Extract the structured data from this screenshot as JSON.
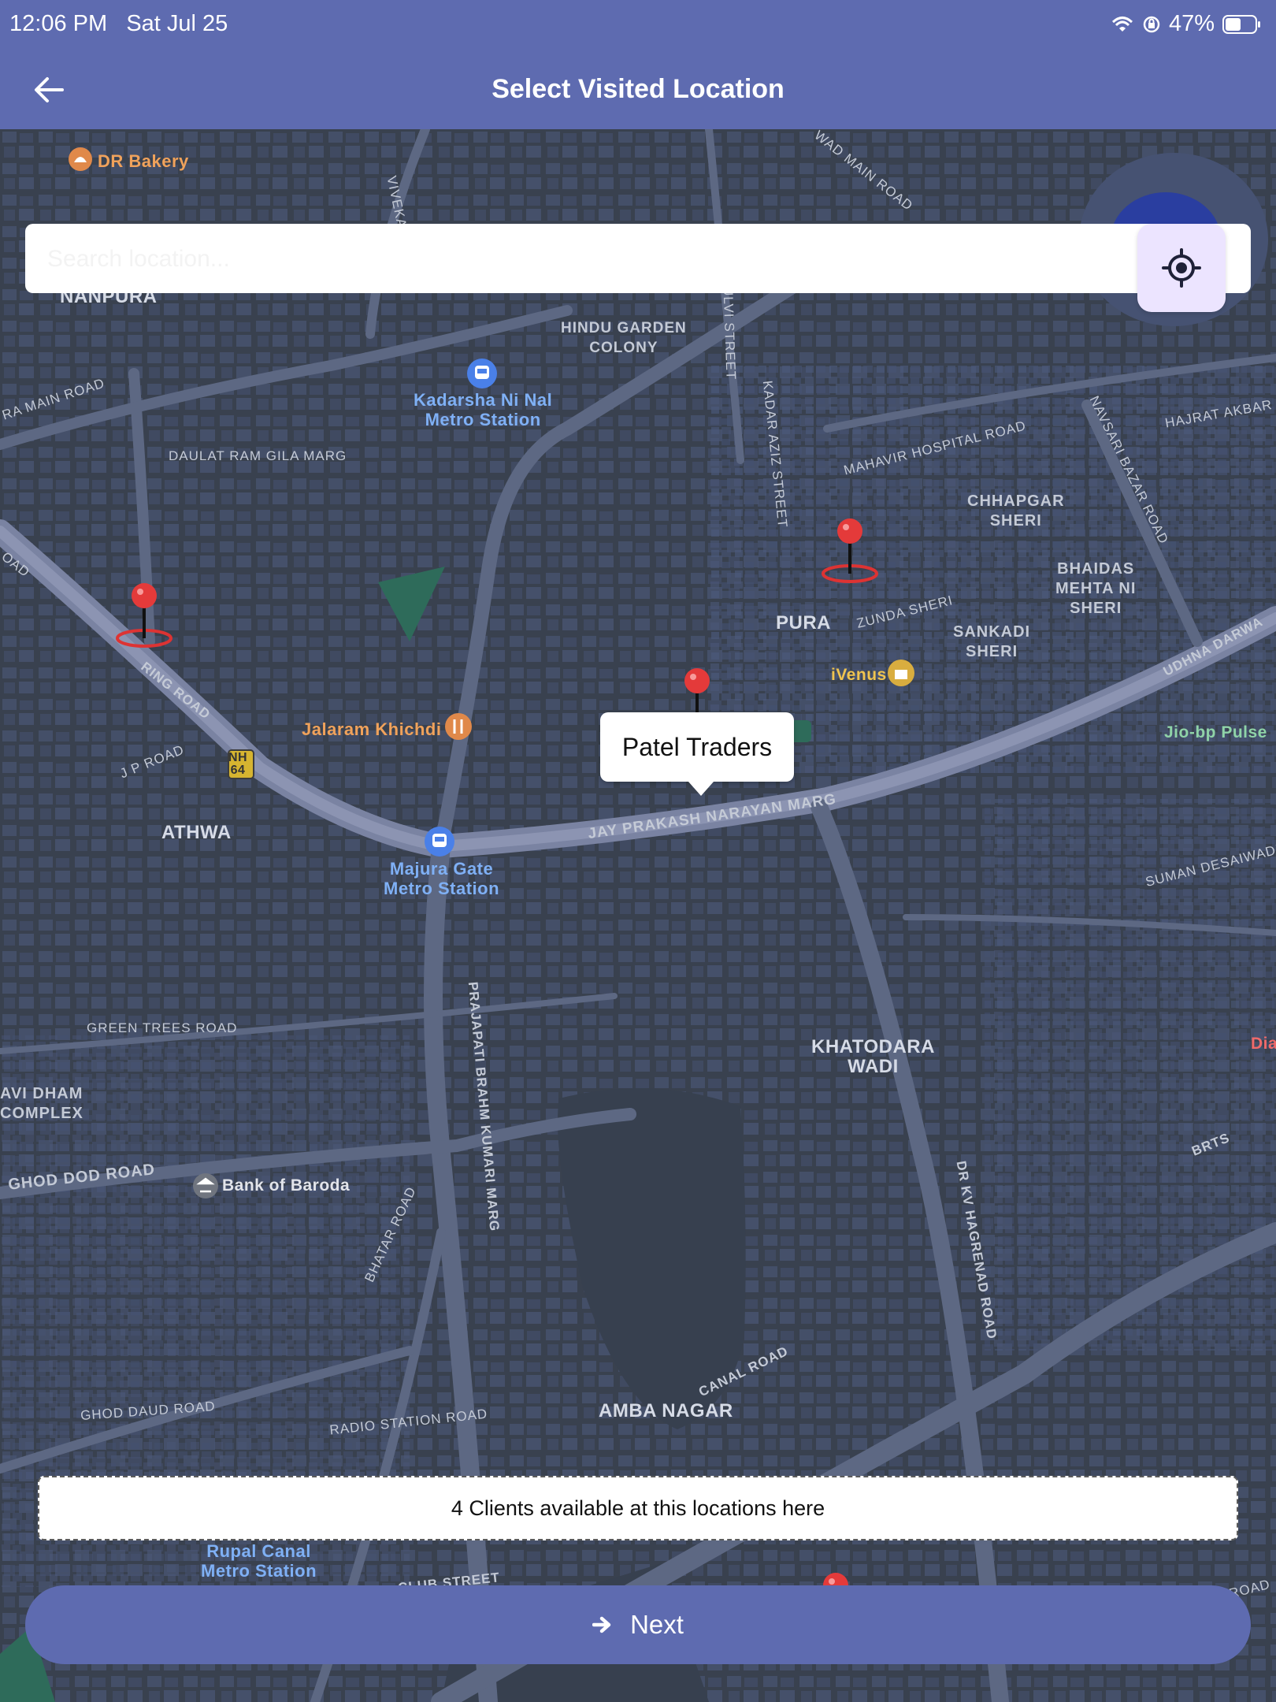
{
  "status_bar": {
    "time": "12:06 PM",
    "date": "Sat Jul 25",
    "battery": "47%",
    "icons": [
      "wifi-icon",
      "orientation-lock-icon",
      "battery-icon"
    ]
  },
  "app_bar": {
    "title": "Select Visited Location",
    "back_icon": "arrow-left-icon"
  },
  "search": {
    "placeholder": "Search location...",
    "value": ""
  },
  "locate_button": {
    "icon": "crosshair-icon"
  },
  "map": {
    "labels": {
      "nanpura": "NANPURA",
      "hindu_garden": "HINDU GARDEN\nCOLONY",
      "kadarsha_station": "Kadarsha Ni Nal\nMetro Station",
      "dr_bakery": "DR Bakery",
      "chhapgar": "CHHAPGAR\nSHERI",
      "bhaidas": "BHAIDAS\nMEHTA NI\nSHERI",
      "sankadi": "SANKADI\nSHERI",
      "ivenus": "iVenus",
      "jio_bp": "Jio-bp Pulse",
      "jalaram": "Jalaram Khichdi",
      "athwa": "ATHWA",
      "majura_station": "Majura Gate\nMetro Station",
      "khatodara": "KHATODARA\nWADI",
      "avi_dham": "AVI DHAM\nCOMPLEX",
      "bank_baroda": "Bank of Baroda",
      "amba_nagar": "AMBA NAGAR",
      "rupal_station": "Rupal Canal\nMetro Station",
      "pura": "PURA",
      "dia": "Dia",
      "nh64": "NH\n64"
    },
    "roads": {
      "main_road_left": "RA MAIN ROAD",
      "daulat": "DAULAT RAM GILA MARG",
      "mahavir": "MAHAVIR HOSPITAL ROAD",
      "navsari": "NAVSARI BAZAR ROAD",
      "hajrat": "HAJRAT AKBAR SH",
      "zunda": "ZUNDA SHERI",
      "udhna": "UDHNA DARWA",
      "ring": "RING ROAD",
      "jp": "J P ROAD",
      "jay_prakash": "JAY PRAKASH NARAYAN MARG",
      "suman": "SUMAN DESAIWADI",
      "green_trees": "GREEN TREES ROAD",
      "prajapati": "PRAJAPATI BRAHM KUMARI MARG",
      "ghod_dod": "GHOD DOD ROAD",
      "bhatar": "BHATAR ROAD",
      "dr_kv": "DR KV HAGRENAD ROAD",
      "brts": "BRTS",
      "canal": "CANAL ROAD",
      "ghod_daud": "GHOD DAUD ROAD",
      "radio_station": "RADIO STATION ROAD",
      "club": "CLUB STREET",
      "aulvi": "AULVI STREET",
      "kadarazi": "KADAR AZIZ STREET",
      "viveka": "VIVEKA",
      "wad_main": "WAD MAIN ROAD",
      "oad": "OAD",
      "road_br": "ROAD"
    },
    "callout": "Patel Traders"
  },
  "banner": {
    "text": "4 Clients available at this locations here"
  },
  "next_button": {
    "label": "Next",
    "icon": "arrow-right-icon"
  }
}
